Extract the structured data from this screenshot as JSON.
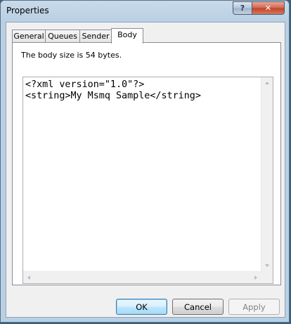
{
  "window": {
    "title": "Properties",
    "help_label": "?",
    "close_label": "✕"
  },
  "tabs": [
    {
      "label": "General",
      "active": false
    },
    {
      "label": "Queues",
      "active": false
    },
    {
      "label": "Sender",
      "active": false
    },
    {
      "label": "Body",
      "active": true
    }
  ],
  "body": {
    "size_text": "The body size is 54 bytes.",
    "content_line1": "<?xml version=\"1.0\"?>",
    "content_line2": "<string>My Msmq Sample</string>"
  },
  "buttons": {
    "ok": "OK",
    "cancel": "Cancel",
    "apply": "Apply"
  }
}
